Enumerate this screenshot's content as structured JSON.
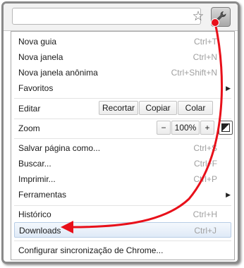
{
  "toolbar": {
    "bookmark_icon": "star-icon",
    "wrench_icon": "wrench-icon"
  },
  "menu": {
    "nova_guia": {
      "label": "Nova guia",
      "shortcut": "Ctrl+T"
    },
    "nova_janela": {
      "label": "Nova janela",
      "shortcut": "Ctrl+N"
    },
    "nova_janela_anonima": {
      "label": "Nova janela anônima",
      "shortcut": "Ctrl+Shift+N"
    },
    "favoritos": {
      "label": "Favoritos"
    },
    "editar": {
      "label": "Editar",
      "recortar": "Recortar",
      "copiar": "Copiar",
      "colar": "Colar"
    },
    "zoom": {
      "label": "Zoom",
      "minus": "−",
      "value": "100%",
      "plus": "+",
      "fullscreen_icon": "fullscreen-icon"
    },
    "salvar": {
      "label": "Salvar página como...",
      "shortcut": "Ctrl+S"
    },
    "buscar": {
      "label": "Buscar...",
      "shortcut": "Ctrl+F"
    },
    "imprimir": {
      "label": "Imprimir...",
      "shortcut": "Ctrl+P"
    },
    "ferramentas": {
      "label": "Ferramentas"
    },
    "historico": {
      "label": "Histórico",
      "shortcut": "Ctrl+H"
    },
    "downloads": {
      "label": "Downloads",
      "shortcut": "Ctrl+J"
    },
    "sincronizacao": {
      "label": "Configurar sincronização de Chrome..."
    }
  },
  "annotation": {
    "color": "#e8101a"
  }
}
